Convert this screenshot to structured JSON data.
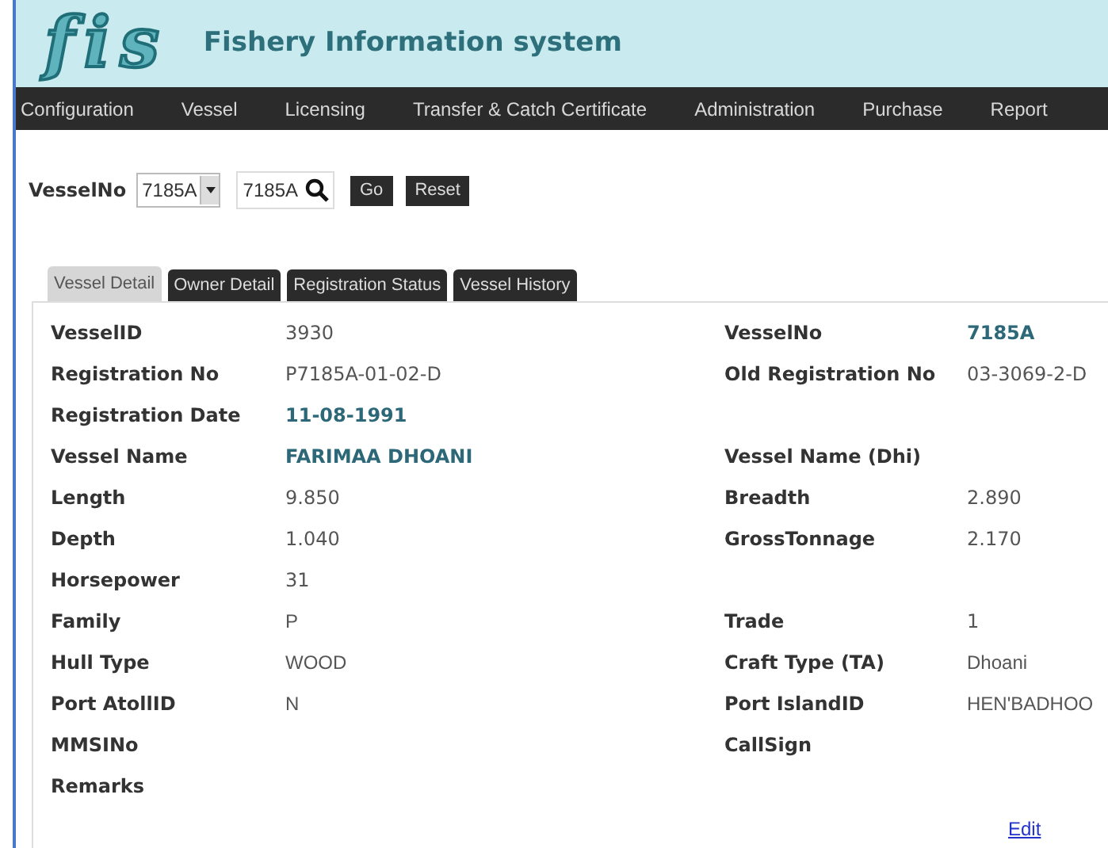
{
  "header": {
    "logo": "fis",
    "title": "Fishery Information system"
  },
  "nav": [
    "Configuration",
    "Vessel",
    "Licensing",
    "Transfer & Catch Certificate",
    "Administration",
    "Purchase",
    "Report"
  ],
  "search": {
    "label": "VesselNo",
    "dropdown_value": "7185A",
    "input_value": "7185A",
    "buttons": [
      "Go",
      "Reset"
    ]
  },
  "tabs": [
    {
      "label": "Vessel Detail",
      "selected": true
    },
    {
      "label": "Owner Detail",
      "selected": false
    },
    {
      "label": "Registration Status",
      "selected": false
    },
    {
      "label": "Vessel History",
      "selected": false
    }
  ],
  "fields": [
    [
      {
        "label": "VesselID",
        "value": "3930",
        "kind": "plain"
      },
      {
        "label": "VesselNo",
        "value": "7185A",
        "kind": "highlight"
      }
    ],
    [
      {
        "label": "Registration No",
        "value": "P7185A-01-02-D",
        "kind": "plain"
      },
      {
        "label": "Old Registration No",
        "value": "03-3069-2-D",
        "kind": "plain"
      }
    ],
    [
      {
        "label": "Registration Date",
        "value": "11-08-1991",
        "kind": "highlight"
      }
    ],
    [
      {
        "label": "Vessel Name",
        "value": "FARIMAA DHOANI",
        "kind": "highlight"
      },
      {
        "label": "Vessel Name (Dhi)"
      }
    ],
    [
      {
        "label": "Length",
        "value": "9.850",
        "kind": "plain"
      },
      {
        "label": "Breadth",
        "value": "2.890",
        "kind": "plain"
      }
    ],
    [
      {
        "label": "Depth",
        "value": "1.040",
        "kind": "plain"
      },
      {
        "label": "GrossTonnage",
        "value": "2.170",
        "kind": "plain"
      }
    ],
    [
      {
        "label": "Horsepower",
        "value": "31",
        "kind": "plain"
      }
    ],
    [
      {
        "label": "Family",
        "value": "P",
        "kind": "sans"
      },
      {
        "label": "Trade",
        "value": "1",
        "kind": "plain"
      }
    ],
    [
      {
        "label": "Hull Type",
        "value": "WOOD",
        "kind": "sans"
      },
      {
        "label": "Craft Type (TA)",
        "value": "Dhoani",
        "kind": "sans"
      }
    ],
    [
      {
        "label": "Port AtollID",
        "value": "N",
        "kind": "sans"
      },
      {
        "label": "Port IslandID",
        "value": "HEN'BADHOO",
        "kind": "sans"
      }
    ],
    [
      {
        "label": "MMSINo"
      },
      {
        "label": "CallSign"
      }
    ],
    [
      {
        "label": "Remarks"
      }
    ]
  ],
  "edit_link": "Edit"
}
